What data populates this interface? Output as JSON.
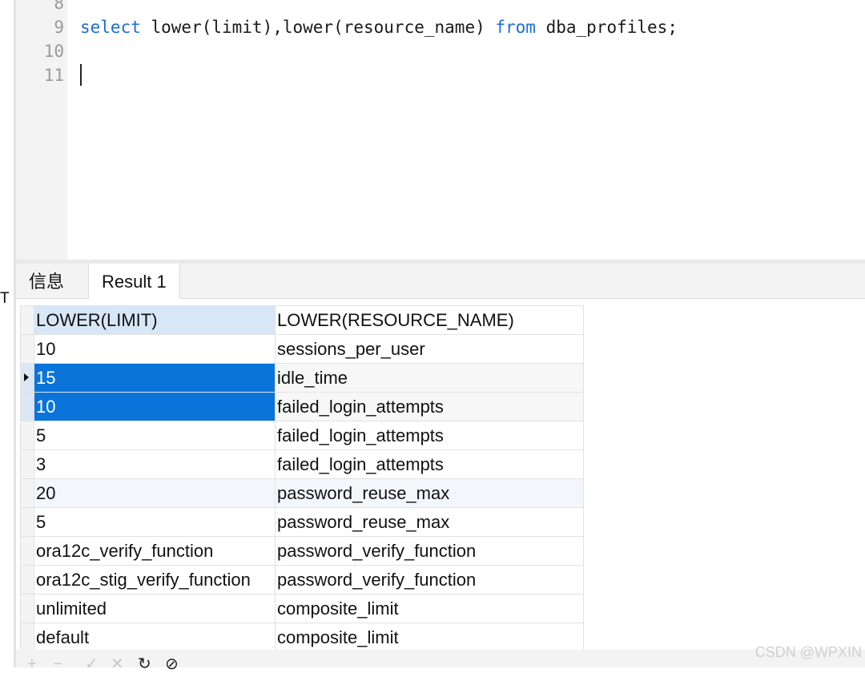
{
  "left_pane": {
    "letter": "T"
  },
  "editor": {
    "line_numbers": [
      "8",
      "9",
      "10",
      "11"
    ],
    "code": {
      "kw_select": "select",
      "part1": " lower(limit),lower(resource_name) ",
      "kw_from": "from",
      "part2": " dba_profiles;"
    }
  },
  "tabs": {
    "info": "信息",
    "result": "Result 1"
  },
  "grid": {
    "columns": [
      "LOWER(LIMIT)",
      "LOWER(RESOURCE_NAME)"
    ],
    "rows": [
      [
        "10",
        "sessions_per_user"
      ],
      [
        "15",
        "idle_time"
      ],
      [
        "10",
        "failed_login_attempts"
      ],
      [
        "5",
        "failed_login_attempts"
      ],
      [
        "3",
        "failed_login_attempts"
      ],
      [
        "20",
        "password_reuse_max"
      ],
      [
        "5",
        "password_reuse_max"
      ],
      [
        "ora12c_verify_function",
        "password_verify_function"
      ],
      [
        "ora12c_stig_verify_function",
        "password_verify_function"
      ],
      [
        "unlimited",
        "composite_limit"
      ],
      [
        "default",
        "composite_limit"
      ]
    ]
  },
  "toolbar": {
    "icons": [
      "plus-icon",
      "minus-icon",
      "check-icon",
      "cancel-icon",
      "refresh-icon",
      "stop-icon"
    ]
  },
  "watermark": "CSDN @WPXIN",
  "colors": {
    "keyword": "#1a6fd6",
    "selection": "#0a74da"
  }
}
